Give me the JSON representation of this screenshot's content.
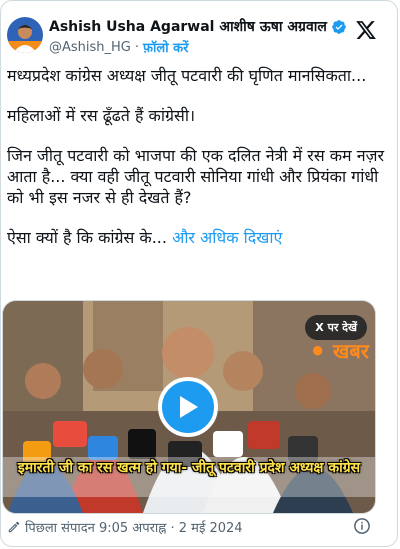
{
  "author": {
    "name": "Ashish Usha Agarwal आशीष ऊषा अग्रवाल",
    "handle": "@Ashish_HG",
    "separator": "·",
    "follow_label": "फ़ॉलो करें"
  },
  "tweet": {
    "line1": "मध्यप्रदेश कांग्रेस अध्यक्ष जीतू पटवारी की घृणित मानसिकता...",
    "line2": "महिलाओं में रस ढूँढते हैं कांग्रेसी।",
    "line3": "जिन जीतू पटवारी को भाजपा की एक दलित नेत्री में रस कम नज़र आता है... क्या वही जीतू पटवारी सोनिया गांधी और प्रियंका गांधी को भी इस नजर से ही देखते हैं?",
    "line4": "ऐसा क्यों है कि कांग्रेस के...",
    "show_more": "और अधिक दिखाएं"
  },
  "media": {
    "watch_on_x": "X पर देखें",
    "brand": "खबर",
    "caption": "इमारती जी का रस खत्म हो गया- जीतू पटवारी प्रदेश अध्यक्ष कांग्रेस"
  },
  "footer": {
    "edited": "पिछला संपादन 9:05 अपराह्न · 2 मई 2024"
  },
  "colors": {
    "accent": "#1d9bf0",
    "text": "#0f1419",
    "muted": "#536471",
    "caption": "#ffe14a"
  }
}
